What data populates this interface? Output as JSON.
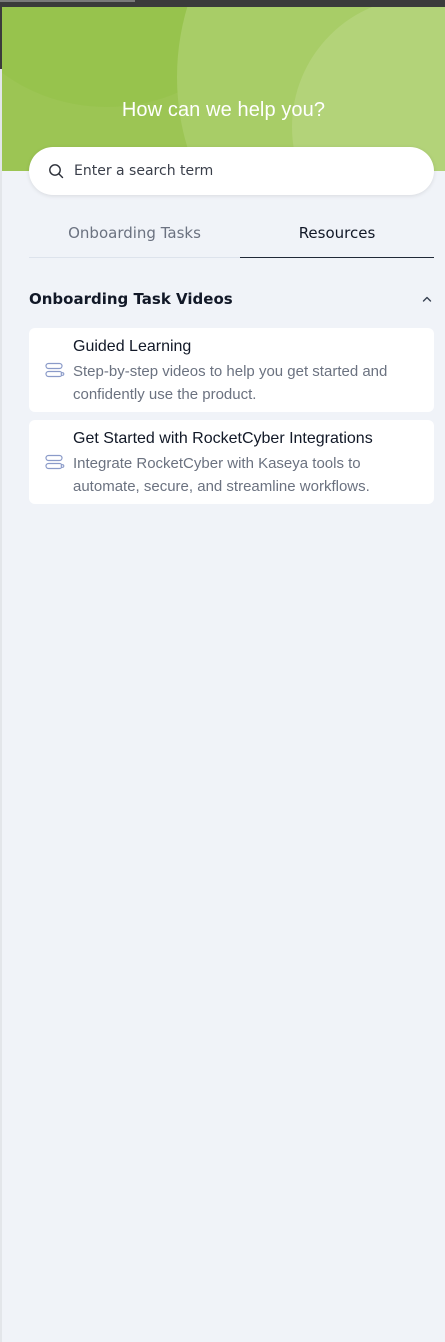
{
  "hero": {
    "title": "How can we help you?"
  },
  "search": {
    "placeholder": "Enter a search term",
    "value": ""
  },
  "tabs": [
    {
      "label": "Onboarding Tasks",
      "active": false
    },
    {
      "label": "Resources",
      "active": true
    }
  ],
  "section": {
    "title": "Onboarding Task Videos",
    "expanded": true
  },
  "cards": [
    {
      "title": "Guided Learning",
      "description": "Step-by-step videos to help you get started and confidently use the product.",
      "icon": "route-icon"
    },
    {
      "title": "Get Started with RocketCyber Integrations",
      "description": "Integrate RocketCyber with Kaseya tools to automate, secure, and streamline workflows.",
      "icon": "route-icon"
    }
  ],
  "colors": {
    "hero_green": "#9cc554",
    "background": "#f0f3f8",
    "text_primary": "#111827",
    "text_secondary": "#6b7280",
    "icon_accent": "#8b9bc9"
  }
}
